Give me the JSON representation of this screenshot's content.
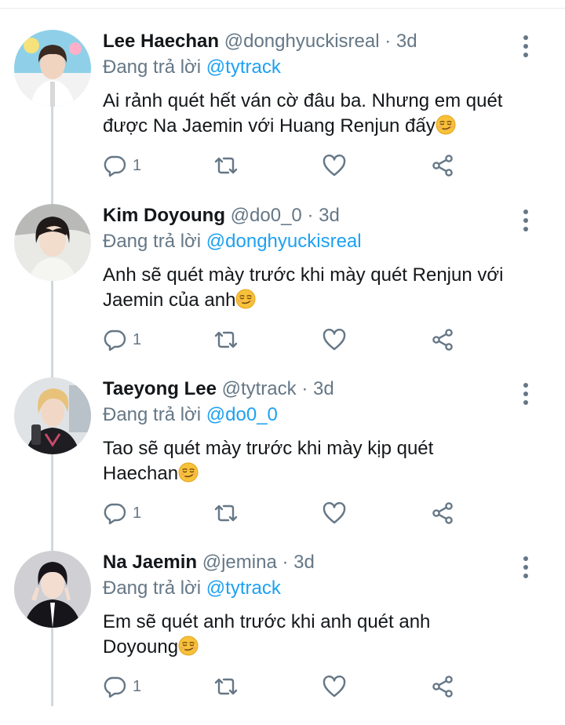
{
  "tweets": [
    {
      "name": "Lee Haechan",
      "handle": "@donghyuckisreal",
      "dot": "·",
      "time": "3d",
      "reply_prefix": "Đang trả lời",
      "reply_to": "@tytrack",
      "text": "Ai rảnh quét hết ván cờ đâu ba. Nhưng em quét được Na Jaemin với Huang Renjun đấy",
      "emoji": "smirk-emoji",
      "replies": "1",
      "icons": [
        "reply-icon",
        "retweet-icon",
        "like-icon",
        "share-icon",
        "more-icon"
      ]
    },
    {
      "name": "Kim Doyoung",
      "handle": "@do0_0",
      "dot": "·",
      "time": "3d",
      "reply_prefix": "Đang trả lời",
      "reply_to": "@donghyuckisreal",
      "text": "Anh sẽ quét mày trước khi mày quét Renjun với Jaemin của anh",
      "emoji": "smirk-emoji",
      "replies": "1",
      "icons": [
        "reply-icon",
        "retweet-icon",
        "like-icon",
        "share-icon",
        "more-icon"
      ]
    },
    {
      "name": "Taeyong Lee",
      "handle": "@tytrack",
      "dot": "·",
      "time": "3d",
      "reply_prefix": "Đang trả lời",
      "reply_to": "@do0_0",
      "text": "Tao sẽ quét mày trước khi mày kịp quét Haechan",
      "emoji": "smirk-emoji",
      "replies": "1",
      "icons": [
        "reply-icon",
        "retweet-icon",
        "like-icon",
        "share-icon",
        "more-icon"
      ]
    },
    {
      "name": "Na Jaemin",
      "handle": "@jemina",
      "dot": "·",
      "time": "3d",
      "reply_prefix": "Đang trả lời",
      "reply_to": "@tytrack",
      "text": "Em sẽ quét anh trước khi anh quét anh Doyoung",
      "emoji": "smirk-emoji",
      "replies": "1",
      "icons": [
        "reply-icon",
        "retweet-icon",
        "like-icon",
        "share-icon",
        "more-icon"
      ]
    }
  ],
  "colors": {
    "link": "#1da1f2",
    "muted": "#657786",
    "text": "#14171a",
    "thread_line": "#cfd9de"
  }
}
